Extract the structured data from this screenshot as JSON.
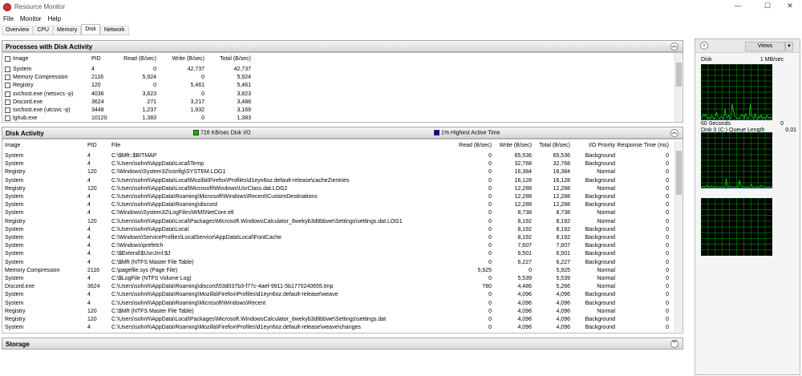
{
  "window": {
    "title": "Resource Monitor",
    "controls": [
      "—",
      "☐",
      "✕"
    ]
  },
  "menu": [
    "File",
    "Monitor",
    "Help"
  ],
  "tabs": [
    {
      "label": "Overview"
    },
    {
      "label": "CPU"
    },
    {
      "label": "Memory"
    },
    {
      "label": "Disk",
      "active": true
    },
    {
      "label": "Network"
    }
  ],
  "processes": {
    "title": "Processes with Disk Activity",
    "columns": [
      "Image",
      "PID",
      "Read (B/sec)",
      "Write (B/sec)",
      "Total (B/sec)"
    ],
    "rows": [
      [
        "System",
        "4",
        "0",
        "42,737",
        "42,737"
      ],
      [
        "Memory Compression",
        "2116",
        "5,924",
        "0",
        "5,924"
      ],
      [
        "Registry",
        "120",
        "0",
        "5,461",
        "5,461"
      ],
      [
        "svchost.exe (netsvcs -p)",
        "4036",
        "3,823",
        "0",
        "3,823"
      ],
      [
        "Discord.exe",
        "3624",
        "271",
        "3,217",
        "3,488"
      ],
      [
        "svchost.exe (utcsvc -p)",
        "3448",
        "1,237",
        "1,932",
        "3,169"
      ],
      [
        "lghub.exe",
        "10120",
        "1,383",
        "0",
        "1,383"
      ]
    ]
  },
  "disk_activity": {
    "title": "Disk Activity",
    "io_label": "728 KB/sec Disk I/O",
    "io_color": "#00c000",
    "active_label": "1% Highest Active Time",
    "active_color": "#0000c0",
    "columns": [
      "Image",
      "PID",
      "File",
      "Read (B/sec)",
      "Write (B/sec)",
      "Total (B/sec)",
      "I/O Priority",
      "Response Time (ms)"
    ],
    "rows": [
      [
        "System",
        "4",
        "C:\\$Mft::$BITMAP",
        "0",
        "65,536",
        "65,536",
        "Background",
        "0"
      ],
      [
        "System",
        "4",
        "C:\\Users\\sohnh\\AppData\\Local\\Temp",
        "0",
        "32,768",
        "32,768",
        "Background",
        "0"
      ],
      [
        "Registry",
        "120",
        "C:\\Windows\\System32\\config\\SYSTEM.LOG1",
        "0",
        "16,384",
        "16,384",
        "Normal",
        "0"
      ],
      [
        "System",
        "4",
        "C:\\Users\\sohnh\\AppData\\Local\\Mozilla\\Firefox\\Profiles\\d1eyn6oz.default-release\\cache2\\entries",
        "0",
        "16,128",
        "16,128",
        "Background",
        "0"
      ],
      [
        "Registry",
        "120",
        "C:\\Users\\sohnh\\AppData\\Local\\Microsoft\\Windows\\UsrClass.dat.LOG2",
        "0",
        "12,288",
        "12,288",
        "Normal",
        "0"
      ],
      [
        "System",
        "4",
        "C:\\Users\\sohnh\\AppData\\Roaming\\Microsoft\\Windows\\Recent\\CustomDestinations",
        "0",
        "12,288",
        "12,288",
        "Background",
        "0"
      ],
      [
        "System",
        "4",
        "C:\\Users\\sohnh\\AppData\\Roaming\\discord",
        "0",
        "12,288",
        "12,288",
        "Background",
        "0"
      ],
      [
        "System",
        "4",
        "C:\\Windows\\System32\\LogFiles\\WMI\\NetCore.etl",
        "0",
        "8,738",
        "8,738",
        "Normal",
        "0"
      ],
      [
        "Registry",
        "120",
        "C:\\Users\\sohnh\\AppData\\Local\\Packages\\Microsoft.WindowsCalculator_8wekyb3d8bbwe\\Settings\\settings.dat.LOG1",
        "0",
        "8,192",
        "8,192",
        "Normal",
        "0"
      ],
      [
        "System",
        "4",
        "C:\\Users\\sohnh\\AppData\\Local",
        "0",
        "8,192",
        "8,192",
        "Background",
        "0"
      ],
      [
        "System",
        "4",
        "C:\\Windows\\ServiceProfiles\\LocalService\\AppData\\Local\\FontCache",
        "0",
        "8,192",
        "8,192",
        "Background",
        "0"
      ],
      [
        "System",
        "4",
        "C:\\Windows\\prefetch",
        "0",
        "7,607",
        "7,607",
        "Background",
        "0"
      ],
      [
        "System",
        "4",
        "C:\\$Extend\\$UsnJrnl:$J",
        "0",
        "6,501",
        "6,501",
        "Background",
        "0"
      ],
      [
        "System",
        "4",
        "C:\\$Mft (NTFS Master File Table)",
        "0",
        "6,227",
        "6,227",
        "Background",
        "0"
      ],
      [
        "Memory Compression",
        "2116",
        "C:\\pagefile.sys (Page File)",
        "5,925",
        "0",
        "5,925",
        "Normal",
        "0"
      ],
      [
        "System",
        "4",
        "C:\\$LogFile (NTFS Volume Log)",
        "0",
        "5,539",
        "5,539",
        "Normal",
        "0"
      ],
      [
        "Discord.exe",
        "3624",
        "C:\\Users\\sohnh\\AppData\\Roaming\\discord\\53d037b3-f77c-4aef-9911-5b1770240655.tmp",
        "780",
        "4,486",
        "5,266",
        "Normal",
        "0"
      ],
      [
        "System",
        "4",
        "C:\\Users\\sohnh\\AppData\\Roaming\\Mozilla\\Firefox\\Profiles\\d1eyn6oz.default-release\\weave",
        "0",
        "4,096",
        "4,096",
        "Background",
        "0"
      ],
      [
        "System",
        "4",
        "C:\\Users\\sohnh\\AppData\\Roaming\\Microsoft\\Windows\\Recent",
        "0",
        "4,096",
        "4,096",
        "Background",
        "0"
      ],
      [
        "Registry",
        "120",
        "C:\\$Mft (NTFS Master File Table)",
        "0",
        "4,096",
        "4,096",
        "Normal",
        "0"
      ],
      [
        "Registry",
        "120",
        "C:\\Users\\sohnh\\AppData\\Local\\Packages\\Microsoft.WindowsCalculator_8wekyb3d8bbwe\\Settings\\settings.dat",
        "0",
        "4,096",
        "4,096",
        "Background",
        "0"
      ],
      [
        "System",
        "4",
        "C:\\Users\\sohnh\\AppData\\Roaming\\Mozilla\\Firefox\\Profiles\\d1eyn6oz.default-release\\weave\\changes",
        "0",
        "4,096",
        "4,096",
        "Background",
        "0"
      ]
    ]
  },
  "storage": {
    "title": "Storage"
  },
  "side": {
    "views_label": "Views",
    "disk_label": "Disk",
    "disk_scale": "1 MB/sec",
    "time_label": "60 Seconds",
    "time_min": "0",
    "queue_label": "Disk 0 (C:) Queue Length",
    "queue_value": "0.01"
  }
}
